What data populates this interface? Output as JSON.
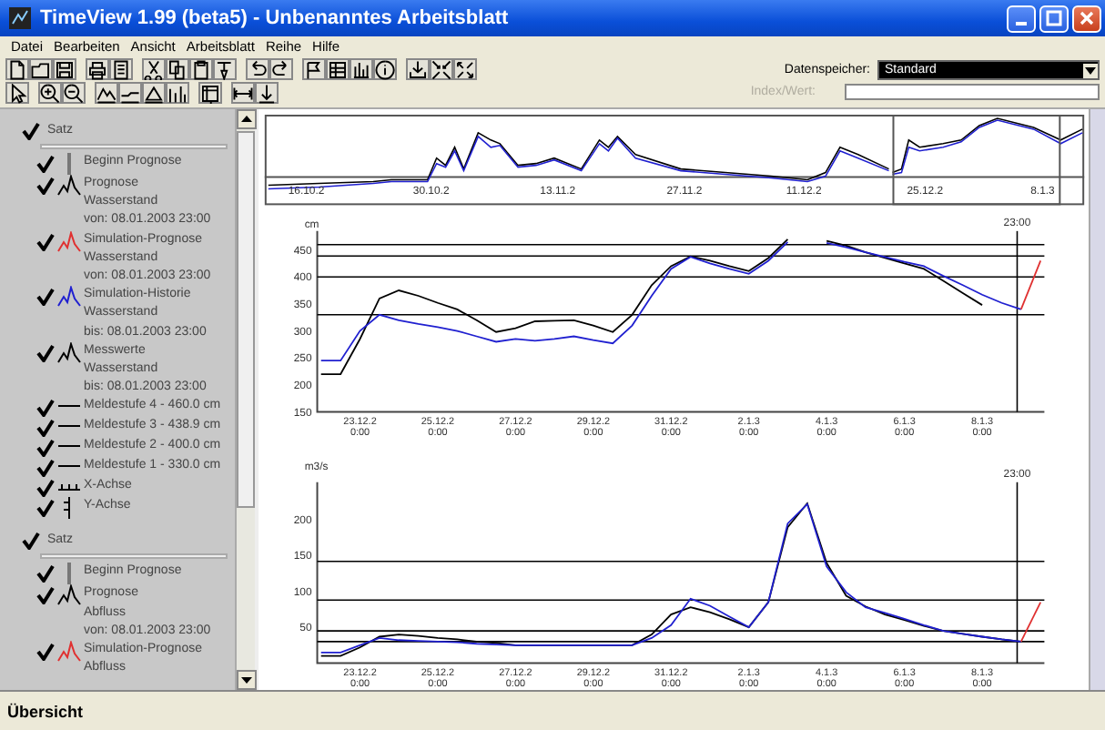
{
  "window": {
    "title": "TimeView 1.99 (beta5) - Unbenanntes Arbeitsblatt"
  },
  "menu": [
    "Datei",
    "Bearbeiten",
    "Ansicht",
    "Arbeitsblatt",
    "Reihe",
    "Hilfe"
  ],
  "toolbar": {
    "storage_label": "Datenspeicher:",
    "storage_value": "Standard",
    "index_label": "Index/Wert:",
    "index_disabled": true
  },
  "tree": [
    {
      "label": "Satz",
      "checked": true,
      "children": [
        {
          "kind": "marker",
          "checked": true,
          "lines": [
            "Beginn Prognose"
          ]
        },
        {
          "kind": "curve",
          "checked": true,
          "color": "#000000",
          "lines": [
            "Prognose",
            "Wasserstand",
            "von: 08.01.2003 23:00"
          ]
        },
        {
          "kind": "curve",
          "checked": true,
          "color": "#e03030",
          "lines": [
            "Simulation-Prognose",
            "Wasserstand",
            "von: 08.01.2003 23:00"
          ]
        },
        {
          "kind": "curve",
          "checked": true,
          "color": "#2020d0",
          "lines": [
            "Simulation-Historie",
            "Wasserstand",
            "bis: 08.01.2003 23:00"
          ]
        },
        {
          "kind": "curve",
          "checked": true,
          "color": "#000000",
          "lines": [
            "Messwerte",
            "Wasserstand",
            "bis: 08.01.2003 23:00"
          ]
        },
        {
          "kind": "level",
          "checked": true,
          "lines": [
            "Meldestufe 4 - 460.0 cm"
          ]
        },
        {
          "kind": "level",
          "checked": true,
          "lines": [
            "Meldestufe 3 - 438.9 cm"
          ]
        },
        {
          "kind": "level",
          "checked": true,
          "lines": [
            "Meldestufe 2 - 400.0 cm"
          ]
        },
        {
          "kind": "level",
          "checked": true,
          "lines": [
            "Meldestufe 1 - 330.0 cm"
          ]
        },
        {
          "kind": "xaxis",
          "checked": true,
          "lines": [
            "X-Achse"
          ]
        },
        {
          "kind": "yaxis",
          "checked": true,
          "lines": [
            "Y-Achse"
          ]
        }
      ]
    },
    {
      "label": "Satz",
      "checked": true,
      "children": [
        {
          "kind": "marker",
          "checked": true,
          "lines": [
            "Beginn Prognose"
          ]
        },
        {
          "kind": "curve",
          "checked": true,
          "color": "#000000",
          "lines": [
            "Prognose",
            "Abfluss",
            "von: 08.01.2003 23:00"
          ]
        },
        {
          "kind": "curve",
          "checked": true,
          "color": "#e03030",
          "lines": [
            "Simulation-Prognose",
            "Abfluss"
          ]
        }
      ]
    }
  ],
  "overview": {
    "x_labels": [
      "16.10.2",
      "30.10.2",
      "13.11.2",
      "27.11.2",
      "11.12.2",
      "25.12.2",
      "8.1.3"
    ]
  },
  "charts": [
    {
      "time_label": "23:00",
      "chart_data": {
        "type": "line",
        "ylabel": "cm",
        "categories": [
          null,
          null,
          "23.12.2 0:00",
          null,
          null,
          null,
          "25.12.2 0:00",
          null,
          null,
          null,
          "27.12.2 0:00",
          null,
          null,
          null,
          "29.12.2 0:00",
          null,
          null,
          null,
          "31.12.2 0:00",
          null,
          null,
          null,
          "2.1.3 0:00",
          null,
          null,
          null,
          "4.1.3 0:00",
          null,
          null,
          null,
          "6.1.3 0:00",
          null,
          null,
          null,
          "8.1.3 0:00",
          null,
          null,
          null
        ],
        "series": [
          {
            "color": "#000000",
            "values": [
              220,
              220,
              285,
              360,
              375,
              365,
              352,
              340,
              320,
              298,
              305,
              318,
              319,
              320,
              310,
              298,
              330,
              385,
              420,
              438,
              430,
              420,
              411,
              435,
              470,
              null,
              467,
              458,
              446,
              435,
              425,
              415,
              393,
              370,
              348,
              null,
              null,
              null
            ]
          },
          {
            "color": "#2020d0",
            "values": [
              245,
              245,
              300,
              330,
              320,
              313,
              307,
              300,
              290,
              280,
              285,
              282,
              285,
              290,
              283,
              277,
              310,
              365,
              415,
              437,
              425,
              415,
              406,
              430,
              465,
              null,
              463,
              455,
              446,
              437,
              428,
              420,
              402,
              385,
              367,
              352,
              340,
              null
            ]
          },
          {
            "color": "#e03030",
            "values": [
              null,
              null,
              null,
              null,
              null,
              null,
              null,
              null,
              null,
              null,
              null,
              null,
              null,
              null,
              null,
              null,
              null,
              null,
              null,
              null,
              null,
              null,
              null,
              null,
              null,
              null,
              null,
              null,
              null,
              null,
              null,
              null,
              null,
              null,
              null,
              null,
              340,
              430
            ]
          }
        ],
        "ylim": [
          150,
          475
        ],
        "yticks": [
          150,
          200,
          250,
          300,
          350,
          400,
          450
        ],
        "ref_lines": [
          {
            "axis": "y",
            "value": 460
          },
          {
            "axis": "y",
            "value": 438.9
          },
          {
            "axis": "y",
            "value": 400
          },
          {
            "axis": "y",
            "value": 330
          }
        ]
      }
    },
    {
      "time_label": "23:00",
      "chart_data": {
        "type": "line",
        "ylabel": "m3/s",
        "categories": [
          null,
          null,
          "23.12.2 0:00",
          null,
          null,
          null,
          "25.12.2 0:00",
          null,
          null,
          null,
          "27.12.2 0:00",
          null,
          null,
          null,
          "29.12.2 0:00",
          null,
          null,
          null,
          "31.12.2 0:00",
          null,
          null,
          null,
          "2.1.3 0:00",
          null,
          null,
          null,
          "4.1.3 0:00",
          null,
          null,
          null,
          "6.1.3 0:00",
          null,
          null,
          null,
          "8.1.3 0:00",
          null,
          null,
          null
        ],
        "series": [
          {
            "color": "#000000",
            "values": [
              10,
              10,
              22,
              37,
              40,
              38,
              35,
              33,
              30,
              28,
              25,
              25,
              25,
              25,
              25,
              25,
              25,
              40,
              68,
              78,
              71,
              61,
              50,
              85,
              190,
              223,
              140,
              94,
              79,
              68,
              60,
              52,
              45,
              41,
              37,
              33,
              30,
              null
            ]
          },
          {
            "color": "#2020d0",
            "values": [
              15,
              15,
              25,
              35,
              32,
              31,
              30,
              29,
              27,
              26,
              25,
              25,
              25,
              25,
              25,
              25,
              25,
              35,
              53,
              90,
              80,
              65,
              50,
              85,
              195,
              222,
              135,
              99,
              78,
              70,
              62,
              53,
              45,
              41,
              37,
              33,
              30,
              null
            ]
          },
          {
            "color": "#e03030",
            "values": [
              null,
              null,
              null,
              null,
              null,
              null,
              null,
              null,
              null,
              null,
              null,
              null,
              null,
              null,
              null,
              null,
              null,
              null,
              null,
              null,
              null,
              null,
              null,
              null,
              null,
              null,
              null,
              null,
              null,
              null,
              null,
              null,
              null,
              null,
              null,
              null,
              30,
              85
            ]
          }
        ],
        "ylim": [
          0,
          245
        ],
        "yticks": [
          50,
          100,
          150,
          200
        ],
        "ref_lines": [
          {
            "axis": "y",
            "value": 142
          },
          {
            "axis": "y",
            "value": 88
          },
          {
            "axis": "y",
            "value": 45
          },
          {
            "axis": "y",
            "value": 30
          }
        ]
      }
    }
  ],
  "status_bar": "Übersicht"
}
